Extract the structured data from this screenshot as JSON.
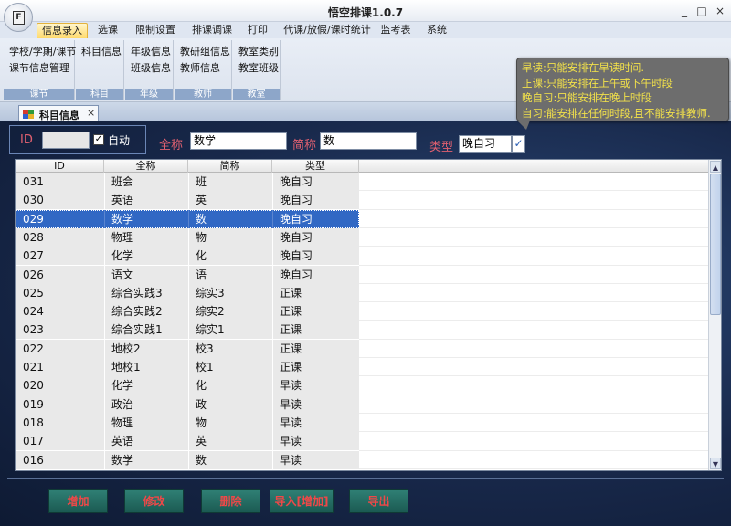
{
  "window": {
    "title": "悟空排课1.0.7",
    "app_icon_letter": "F",
    "minimize": "_",
    "maximize": "□",
    "close": "×"
  },
  "ribbon_tabs": [
    "信息录入",
    "选课",
    "限制设置",
    "排课调课",
    "打印",
    "代课/放假/课时统计",
    "监考表",
    "系统"
  ],
  "ribbon_groups": [
    {
      "items": [
        "学校/学期/课节",
        "课节信息管理"
      ],
      "label": "课节"
    },
    {
      "items": [
        "科目信息"
      ],
      "label": "科目"
    },
    {
      "items": [
        "年级信息",
        "班级信息"
      ],
      "label": "年级"
    },
    {
      "items": [
        "教研组信息",
        "教师信息"
      ],
      "label": "教师"
    },
    {
      "items": [
        "教室类别",
        "教室班级"
      ],
      "label": "教室"
    }
  ],
  "tooltip": {
    "lines": [
      "早读:只能安排在早读时间.",
      "正课:只能安排在上午或下午时段",
      "晚自习:只能安排在晚上时段",
      "自习:能安排在任何时段,且不能安排教师."
    ]
  },
  "doc_tab": {
    "label": "科目信息",
    "close": "×"
  },
  "form": {
    "id_label": "ID",
    "id_value": "",
    "auto_checked": "✓",
    "auto_label": "自动",
    "fullname_label": "全称",
    "fullname_value": "数学",
    "short_label": "简称",
    "short_value": "数",
    "type_label": "类型",
    "type_value": "晚自习",
    "type_check": "✓"
  },
  "table": {
    "columns": [
      "ID",
      "全称",
      "简称",
      "类型"
    ],
    "selected_index": 2,
    "rows": [
      [
        "031",
        "班会",
        "班",
        "晚自习"
      ],
      [
        "030",
        "英语",
        "英",
        "晚自习"
      ],
      [
        "029",
        "数学",
        "数",
        "晚自习"
      ],
      [
        "028",
        "物理",
        "物",
        "晚自习"
      ],
      [
        "027",
        "化学",
        "化",
        "晚自习"
      ],
      [
        "026",
        "语文",
        "语",
        "晚自习"
      ],
      [
        "025",
        "综合实践3",
        "综实3",
        "正课"
      ],
      [
        "024",
        "综合实践2",
        "综实2",
        "正课"
      ],
      [
        "023",
        "综合实践1",
        "综实1",
        "正课"
      ],
      [
        "022",
        "地校2",
        "校3",
        "正课"
      ],
      [
        "021",
        "地校1",
        "校1",
        "正课"
      ],
      [
        "020",
        "化学",
        "化",
        "早读"
      ],
      [
        "019",
        "政治",
        "政",
        "早读"
      ],
      [
        "018",
        "物理",
        "物",
        "早读"
      ],
      [
        "017",
        "英语",
        "英",
        "早读"
      ],
      [
        "016",
        "数学",
        "数",
        "早读"
      ]
    ]
  },
  "scroll": {
    "up": "▲",
    "down": "▼"
  },
  "buttons": {
    "add": "增加",
    "edit": "修改",
    "delete": "删除",
    "import": "导入[增加]",
    "export": "导出"
  },
  "colors": {
    "selected_row": "#3168c4",
    "field_label": "#e06070",
    "button_text": "#f04848",
    "tooltip_text": "#f2e14a"
  }
}
